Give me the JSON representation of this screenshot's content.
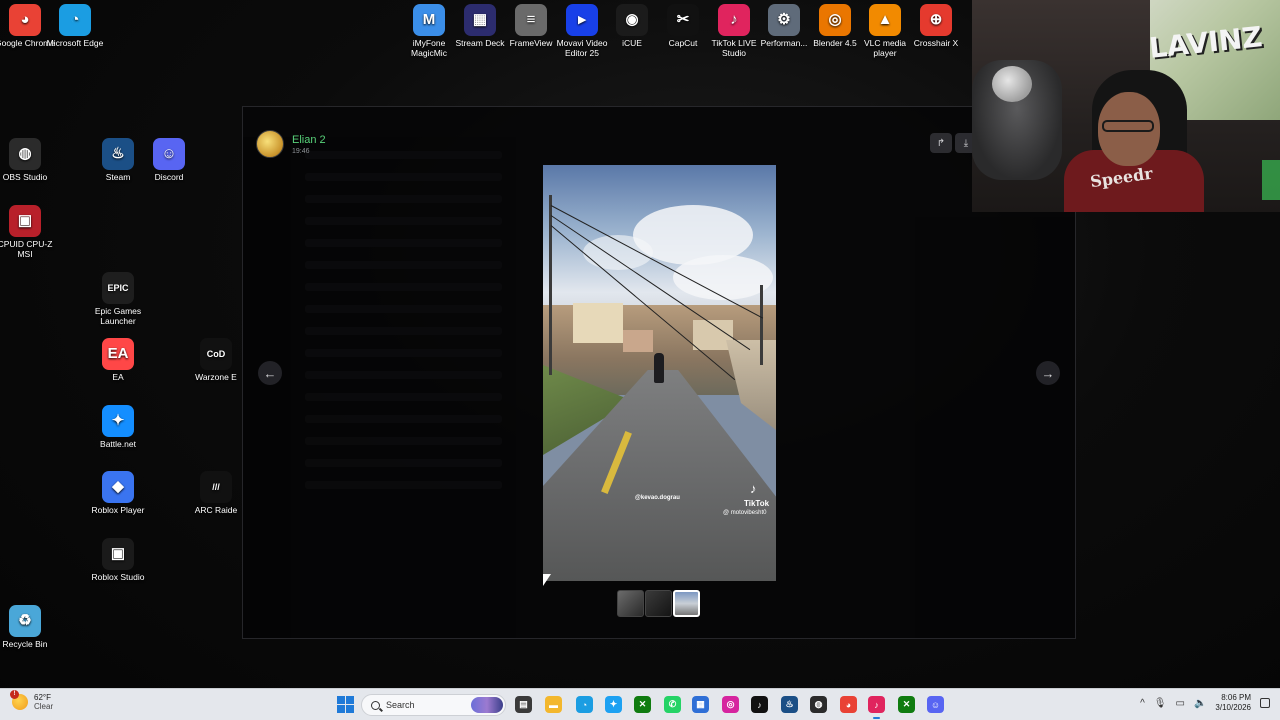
{
  "desktop": {
    "top_icons": [
      {
        "name": "chrome",
        "label": "Google Chrome",
        "color": "#e94235",
        "glyph": "◕"
      },
      {
        "name": "edge",
        "label": "Microsoft Edge",
        "color": "#1b9de2",
        "glyph": "◔"
      },
      {
        "name": "imyfone",
        "label": "iMyFone MagicMic",
        "color": "#3b8ee8",
        "glyph": "M"
      },
      {
        "name": "stream-deck",
        "label": "Stream Deck",
        "color": "#2c2c6e",
        "glyph": "▦"
      },
      {
        "name": "frameview",
        "label": "FrameView",
        "color": "#6a6a6a",
        "glyph": "≡"
      },
      {
        "name": "movavi",
        "label": "Movavi Video Editor 25",
        "color": "#1840e8",
        "glyph": "▸"
      },
      {
        "name": "icue",
        "label": "iCUE",
        "color": "#1b1b1b",
        "glyph": "◉"
      },
      {
        "name": "capcut",
        "label": "CapCut",
        "color": "#111111",
        "glyph": "✂"
      },
      {
        "name": "tiktok-live",
        "label": "TikTok LIVE Studio",
        "color": "#e0245e",
        "glyph": "♪"
      },
      {
        "name": "performance",
        "label": "Performan...",
        "color": "#5f6b7a",
        "glyph": "⚙"
      },
      {
        "name": "blender",
        "label": "Blender 4.5",
        "color": "#ea7600",
        "glyph": "◎"
      },
      {
        "name": "vlc",
        "label": "VLC media player",
        "color": "#f28a00",
        "glyph": "▲"
      },
      {
        "name": "crosshair",
        "label": "Crosshair X",
        "color": "#e53a2e",
        "glyph": "⊕"
      }
    ],
    "left_icons": [
      {
        "name": "obs",
        "label": "OBS Studio",
        "color": "#2b2b2b",
        "glyph": "◍"
      },
      {
        "name": "steam",
        "label": "Steam",
        "color": "#1b4f86",
        "glyph": "♨"
      },
      {
        "name": "discord",
        "label": "Discord",
        "color": "#5865f2",
        "glyph": "☺"
      },
      {
        "name": "cpuz",
        "label": "CPUID CPU-Z MSI",
        "color": "#b8202a",
        "glyph": "▣"
      },
      {
        "name": "epic",
        "label": "Epic Games Launcher",
        "color": "#1e1e1e",
        "glyph": "EPIC"
      },
      {
        "name": "ea",
        "label": "EA",
        "color": "#ff4747",
        "glyph": "EA"
      },
      {
        "name": "warzone",
        "label": "Warzone E",
        "color": "#111111",
        "glyph": "CoD"
      },
      {
        "name": "battlenet",
        "label": "Battle.net",
        "color": "#148eff",
        "glyph": "✦"
      },
      {
        "name": "roblox-player",
        "label": "Roblox Player",
        "color": "#3a74f0",
        "glyph": "◆"
      },
      {
        "name": "arc-raiders",
        "label": "ARC Raide",
        "color": "#111111",
        "glyph": "///"
      },
      {
        "name": "roblox-studio",
        "label": "Roblox Studio",
        "color": "#1a1a1a",
        "glyph": "▣"
      },
      {
        "name": "recycle-bin",
        "label": "Recycle Bin",
        "color": "#4aa7d8",
        "glyph": "♻"
      }
    ]
  },
  "viewer": {
    "username": "Elian 2",
    "time": "19:46",
    "share_glyph": "↱",
    "download_glyph": "⤓",
    "prev_glyph": "←",
    "next_glyph": "→",
    "media": {
      "handle": "@kevao.dograu",
      "brand_icon": "♪",
      "brand": "TikTok",
      "brand_handle": "@ motovibesht0"
    },
    "thumbnail_count": 3,
    "active_thumbnail": 3
  },
  "webcam": {
    "graffiti_text": "LAVINZ",
    "shirt_text": "Speedr"
  },
  "taskbar": {
    "weather_badge": "!",
    "weather_temp": "62°F",
    "weather_condition": "Clear",
    "search_label": "Search",
    "apps": [
      {
        "name": "file-explorer",
        "glyph": "▤",
        "color": "#3a3a3a"
      },
      {
        "name": "folder",
        "glyph": "▬",
        "color": "#f3b72d"
      },
      {
        "name": "edge",
        "glyph": "◔",
        "color": "#1b9de2"
      },
      {
        "name": "twitter",
        "glyph": "✦",
        "color": "#1da1f2"
      },
      {
        "name": "xbox-badge",
        "glyph": "✕",
        "color": "#107c10"
      },
      {
        "name": "whatsapp",
        "glyph": "✆",
        "color": "#25d366"
      },
      {
        "name": "store",
        "glyph": "▦",
        "color": "#2f6fd6"
      },
      {
        "name": "instagram",
        "glyph": "◎",
        "color": "#d6249f"
      },
      {
        "name": "tiktok",
        "glyph": "♪",
        "color": "#111111"
      },
      {
        "name": "steam",
        "glyph": "♨",
        "color": "#1b4f86"
      },
      {
        "name": "obs",
        "glyph": "◍",
        "color": "#2b2b2b"
      },
      {
        "name": "chrome",
        "glyph": "◕",
        "color": "#e94235"
      },
      {
        "name": "tiktok-live",
        "glyph": "♪",
        "color": "#e0245e"
      },
      {
        "name": "xbox",
        "glyph": "✕",
        "color": "#107c10"
      },
      {
        "name": "discord",
        "glyph": "☺",
        "color": "#5865f2"
      }
    ],
    "tray": {
      "chevron": "^",
      "mic": "🎙",
      "network": "▭",
      "volume": "🔈"
    },
    "clock_time": "8:06 PM",
    "clock_date": "3/10/2026"
  }
}
